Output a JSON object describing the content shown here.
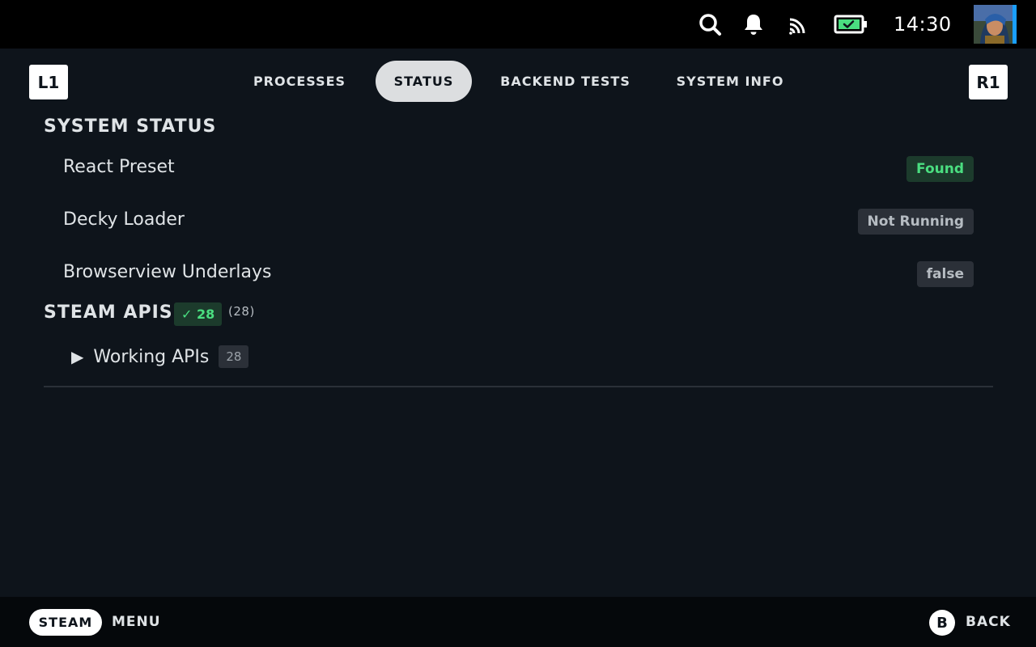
{
  "status_bar": {
    "clock": "14:30",
    "icons": [
      "search-icon",
      "notification-bell-icon",
      "cast-icon",
      "battery-charging-icon"
    ],
    "accent": "#1a9fff",
    "battery_color": "#4ade80"
  },
  "tabs": {
    "left_shoulder": "L1",
    "right_shoulder": "R1",
    "items": [
      {
        "label": "PROCESSES",
        "active": false
      },
      {
        "label": "STATUS",
        "active": true
      },
      {
        "label": "BACKEND TESTS",
        "active": false
      },
      {
        "label": "SYSTEM INFO",
        "active": false
      }
    ]
  },
  "system_status": {
    "title": "SYSTEM STATUS",
    "rows": [
      {
        "label": "React Preset",
        "value": "Found",
        "status": "ok"
      },
      {
        "label": "Decky Loader",
        "value": "Not Running",
        "status": "neutral"
      },
      {
        "label": "Browserview Underlays",
        "value": "false",
        "status": "neutral"
      }
    ]
  },
  "steam_apis": {
    "title": "STEAM APIS",
    "badge": "✓ 28",
    "total": "(28)",
    "items": [
      {
        "arrow": "▶",
        "label": "Working APIs",
        "count": "28"
      }
    ]
  },
  "footer": {
    "steam_label": "STEAM",
    "menu_label": "MENU",
    "b_label": "B",
    "back_label": "BACK"
  },
  "colors": {
    "background": "#0e141b",
    "green_badge_bg": "#1c3b2c",
    "green_text": "#4ade80",
    "gray_badge_bg": "#2b3038"
  }
}
